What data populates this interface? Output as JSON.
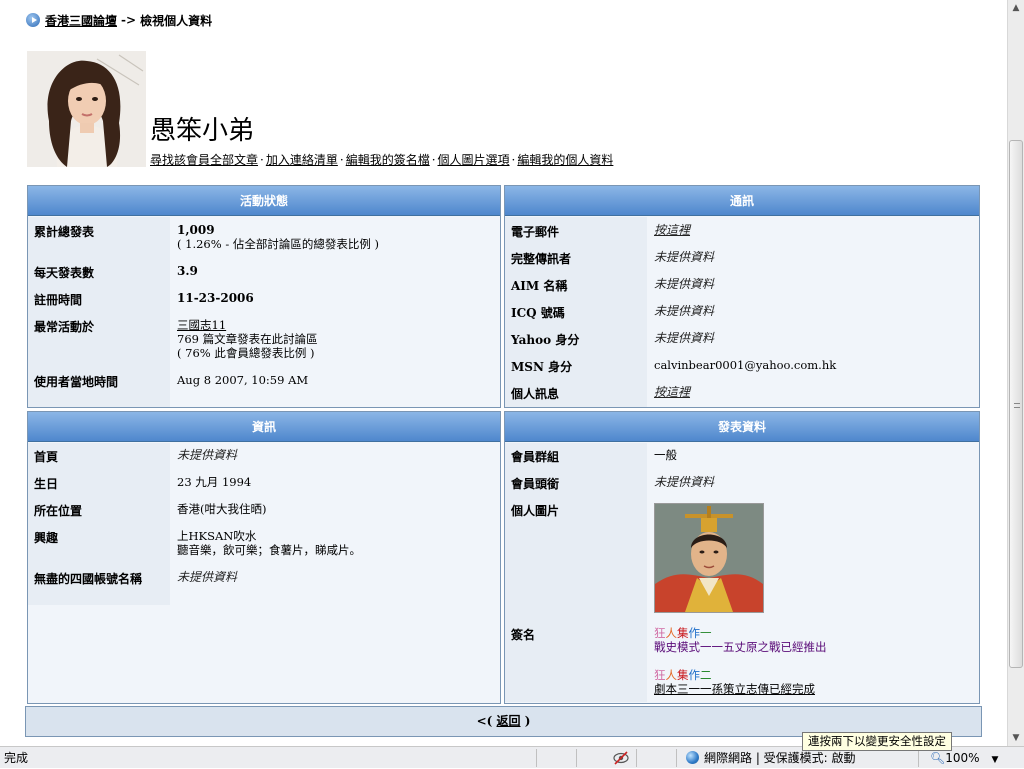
{
  "breadcrumb": {
    "forum": "香港三國論壇",
    "separator": "->",
    "current": "檢視個人資料"
  },
  "profile": {
    "username": "愚笨小弟"
  },
  "links": [
    "尋找該會員全部文章",
    "加入連絡清單",
    "編輯我的簽名檔",
    "個人圖片選項",
    "編輯我的個人資料"
  ],
  "link_separator": "·",
  "activity": {
    "title": "活動狀態",
    "total_posts_label": "累計總發表",
    "total_posts": "1,009",
    "total_posts_note": "( 1.26% - 佔全部討論區的總發表比例 )",
    "per_day_label": "每天發表數",
    "per_day": "3.9",
    "joined_label": "註冊時間",
    "joined": "11-23-2006",
    "most_active_label": "最常活動於",
    "most_active_forum": "三國志11",
    "most_active_posts": "769 篇文章發表在此討論區",
    "most_active_note": "( 76% 此會員總發表比例 )",
    "local_time_label": "使用者當地時間",
    "local_time": "Aug 8 2007, 10:59 AM"
  },
  "contact": {
    "title": "通訊",
    "rows": [
      {
        "label": "電子郵件",
        "value": "按這裡",
        "link": true
      },
      {
        "label": "完整傳訊者",
        "value": "未提供資料",
        "link": false
      },
      {
        "label": "AIM 名稱",
        "value": "未提供資料",
        "link": false
      },
      {
        "label": "ICQ 號碼",
        "value": "未提供資料",
        "link": false
      },
      {
        "label": "Yahoo 身分",
        "value": "未提供資料",
        "link": false
      },
      {
        "label": "MSN 身分",
        "value": "calvinbear0001@yahoo.com.hk",
        "link": false
      },
      {
        "label": "個人訊息",
        "value": "按這裡",
        "link": true
      }
    ]
  },
  "info": {
    "title": "資訊",
    "homepage_label": "首頁",
    "homepage": "未提供資料",
    "birthday_label": "生日",
    "birthday": "23 九月 1994",
    "location_label": "所在位置",
    "location": "香港(咁大我住晒)",
    "interests_label": "興趣",
    "interests_line1": "上HKSAN吹水",
    "interests_line2": "聽音樂，飲可樂；食薯片，睇咸片。",
    "nickname_label": "無盡的四國帳號名稱",
    "nickname": "未提供資料"
  },
  "posting": {
    "title": "發表資料",
    "group_label": "會員群組",
    "group": "一般",
    "rank_label": "會員頭銜",
    "rank": "未提供資料",
    "photo_label": "個人圖片",
    "signature_label": "簽名",
    "sig1_chars": [
      "狂",
      "人",
      "集",
      "作",
      "一"
    ],
    "sig1_line2": "戰史模式一一五丈原之戰已經推出",
    "sig2_chars": [
      "狂",
      "人",
      "集",
      "作",
      "二"
    ],
    "sig2_line2": "劇本三一一孫策立志傳已經完成"
  },
  "return_bar": {
    "open": "<(",
    "label": "返回",
    "close": ")"
  },
  "status_bar": {
    "left": "完成",
    "zone": "網際網路 | 受保護模式: 啟動",
    "zoom": "100%"
  },
  "tooltip": "連按兩下以變更安全性設定",
  "colors": {
    "header_top": "#8bb6e6",
    "header_bottom": "#4f87cd",
    "panel_bg": "#f1f5fa"
  },
  "icons": {
    "breadcrumb": "blue-arrow-bullet-icon",
    "zone": "globe-icon"
  }
}
